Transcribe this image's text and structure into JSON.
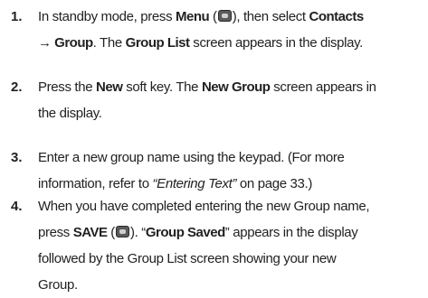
{
  "steps": [
    {
      "number": "1.",
      "l1": "In standby mode, press ",
      "l1_menu": "Menu",
      "l1_paren_open": " (",
      "l1_paren_close": "), then select ",
      "l1_contacts": "Contacts",
      "l2_arrow_group": "→ Group",
      "l2_mid": ". The ",
      "l2_grouplist": "Group List",
      "l2_end": " screen appears in the display."
    },
    {
      "number": "2.",
      "l1_a": "Press the ",
      "l1_new": "New",
      "l1_b": " soft key. The ",
      "l1_newgroup": "New Group",
      "l1_c": " screen appears in",
      "l2": "the display."
    },
    {
      "number": "3.",
      "l1": "Enter a new group name using the keypad. (For more",
      "l2_a": "information, refer to ",
      "l2_link": "“Entering Text”",
      "l2_b": "  on page 33.)"
    },
    {
      "number": "4.",
      "l1": "When you have completed entering the new Group name,",
      "l2_a": "press ",
      "l2_save": "SAVE",
      "l2_paren_open": " (",
      "l2_paren_close": "). “",
      "l2_saved": "Group Saved",
      "l2_b": "” appears in the display",
      "l3": "followed by the Group List screen showing your new",
      "l4": "Group."
    }
  ],
  "icons": {
    "ok_key": "ok-key-icon"
  }
}
